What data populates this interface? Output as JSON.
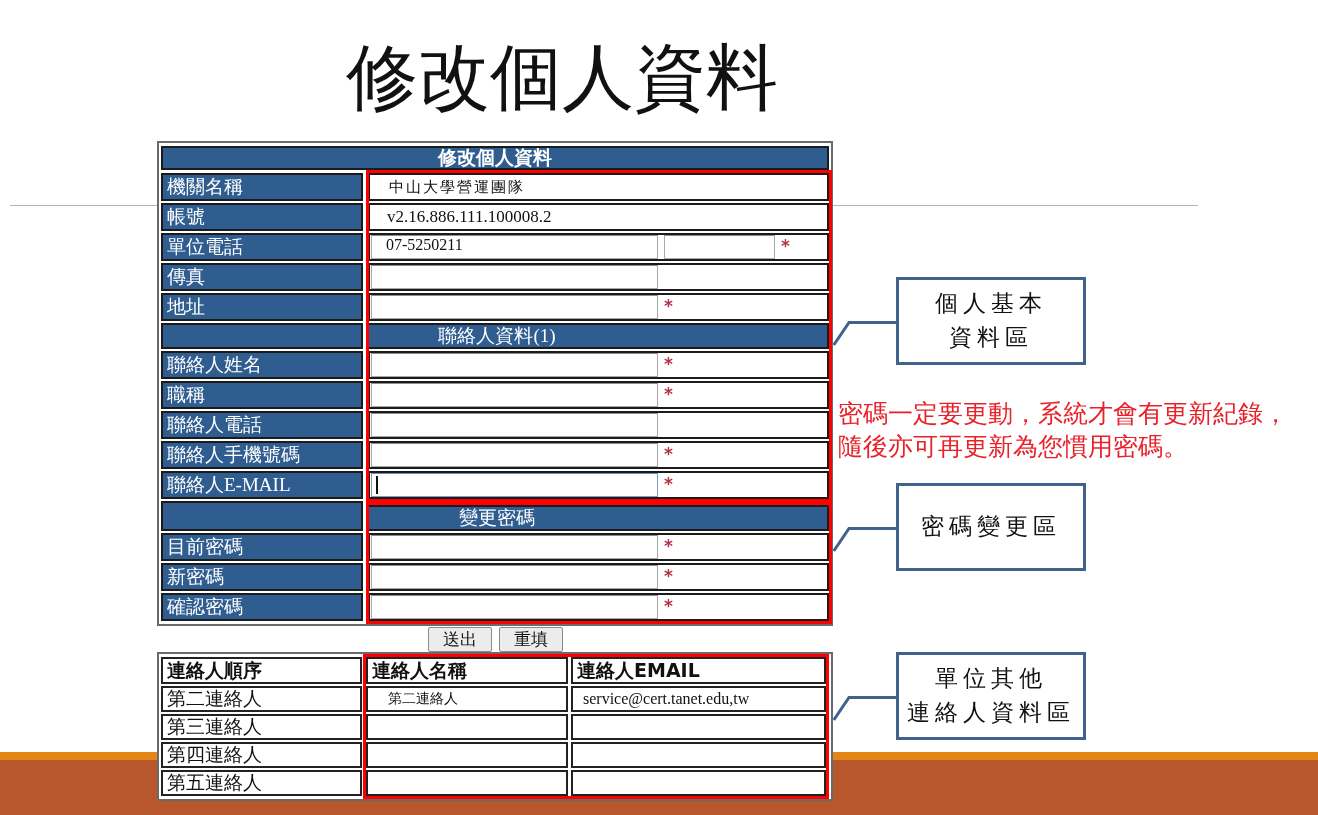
{
  "slide": {
    "title": "修改個人資料"
  },
  "form": {
    "sections": [
      {
        "title": "修改個人資料",
        "rows": [
          {
            "label": "機關名稱",
            "kind": "text",
            "value": "中山大學營運團隊"
          },
          {
            "label": "帳號",
            "kind": "text",
            "value": "v2.16.886.111.100008.2"
          },
          {
            "label": "單位電話",
            "kind": "inputs",
            "inputs": [
              {
                "kind": "wide",
                "value": "07-5250211",
                "focused": false
              },
              {
                "kind": "short",
                "focused": false
              }
            ],
            "required_mark": "*"
          },
          {
            "label": "傳真",
            "kind": "inputs",
            "inputs": [
              {
                "kind": "wide",
                "focused": false
              }
            ]
          },
          {
            "label": "地址",
            "kind": "inputs",
            "inputs": [
              {
                "kind": "wide",
                "focused": false
              }
            ],
            "required_mark": "*"
          }
        ]
      },
      {
        "title": "聯絡人資料(1)",
        "rows": [
          {
            "label": "聯絡人姓名",
            "kind": "inputs",
            "inputs": [
              {
                "kind": "wide",
                "focused": false
              }
            ],
            "required_mark": "*"
          },
          {
            "label": "職稱",
            "kind": "inputs",
            "inputs": [
              {
                "kind": "wide",
                "focused": false
              }
            ],
            "required_mark": "*"
          },
          {
            "label": "聯絡人電話",
            "kind": "inputs",
            "inputs": [
              {
                "kind": "wide",
                "focused": false
              }
            ]
          },
          {
            "label": "聯絡人手機號碼",
            "kind": "inputs",
            "inputs": [
              {
                "kind": "wide",
                "focused": false
              }
            ],
            "required_mark": "*"
          },
          {
            "label": "聯絡人E-MAIL",
            "kind": "inputs",
            "inputs": [
              {
                "kind": "wide",
                "focused": true
              }
            ],
            "required_mark": "*"
          }
        ]
      },
      {
        "title": "變更密碼",
        "rows": [
          {
            "label": "目前密碼",
            "kind": "inputs",
            "inputs": [
              {
                "kind": "wide",
                "focused": false
              }
            ],
            "required_mark": "*"
          },
          {
            "label": "新密碼",
            "kind": "inputs",
            "inputs": [
              {
                "kind": "wide",
                "focused": false
              }
            ],
            "required_mark": "*"
          },
          {
            "label": "確認密碼",
            "kind": "inputs",
            "inputs": [
              {
                "kind": "wide",
                "focused": false
              }
            ],
            "required_mark": "*"
          }
        ]
      }
    ],
    "buttons": [
      "送出",
      "重填"
    ]
  },
  "contacts_table": {
    "columns": [
      "連絡人順序",
      "連絡人名稱",
      "連絡人EMAIL"
    ],
    "rows": [
      {
        "order": "第二連絡人",
        "name": "第二連絡人",
        "email": "service@cert.tanet.edu,tw"
      },
      {
        "order": "第三連絡人"
      },
      {
        "order": "第四連絡人"
      },
      {
        "order": "第五連絡人"
      }
    ]
  },
  "annotations": [
    {
      "kind": "callout",
      "lines": [
        "個人基本",
        "資料區"
      ]
    },
    {
      "kind": "note",
      "lines": [
        "密碼一定要更動，系統才會有更新紀錄，",
        "隨後亦可再更新為您慣用密碼。"
      ]
    },
    {
      "kind": "callout",
      "lines": [
        "密碼變更區"
      ]
    },
    {
      "kind": "callout",
      "lines": [
        "單位其他",
        "連絡人資料區"
      ]
    }
  ]
}
